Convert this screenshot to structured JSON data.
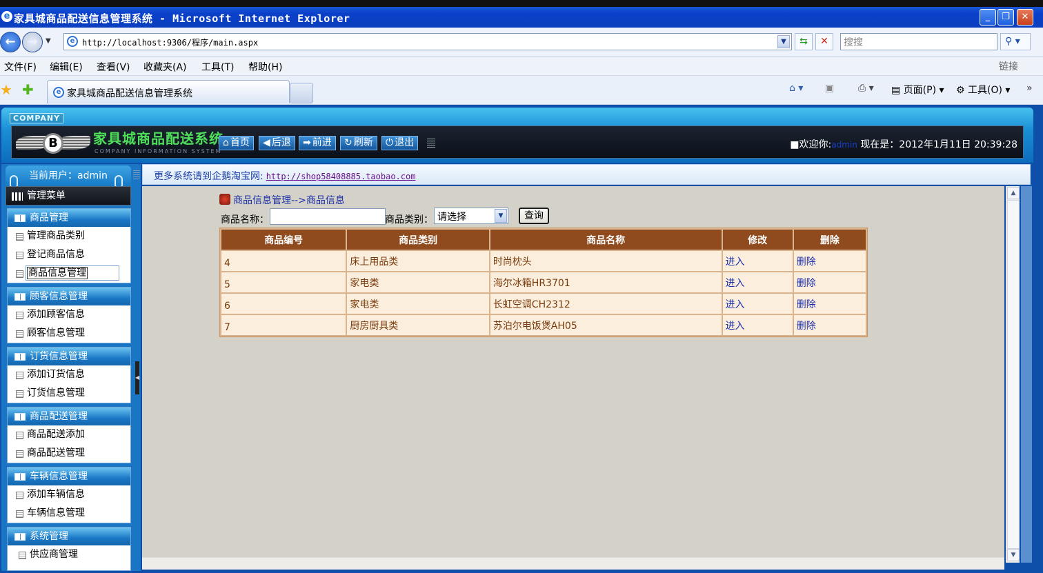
{
  "window": {
    "title": "家具城商品配送信息管理系统 - Microsoft Internet Explorer",
    "minimize": "_",
    "maximize": "❐",
    "close": "✕"
  },
  "address": {
    "url": "http://localhost:9306/程序/main.aspx",
    "search_placeholder": "搜搜"
  },
  "menubar": {
    "items": [
      "文件(F)",
      "编辑(E)",
      "查看(V)",
      "收藏夹(A)",
      "工具(T)",
      "帮助(H)"
    ],
    "links": "链接"
  },
  "tabbar": {
    "tab_title": "家具城商品配送信息管理系统",
    "page_label": "页面(P)",
    "tools_label": "工具(O)"
  },
  "header": {
    "company_tag": "COMPANY",
    "site_title": "家具城商品配送系统",
    "site_subtitle": "COMPANY INFORMATION SYSTEM",
    "nav": [
      "首页",
      "后退",
      "前进",
      "刷新",
      "退出"
    ],
    "welcome_prefix": "欢迎你:",
    "welcome_user": "admin",
    "time_label": "现在是：2012年1月11日 20:39:28"
  },
  "sidebar": {
    "current_user": "当前用户：admin",
    "menu_title": "管理菜单",
    "sections": [
      {
        "title": "商品管理",
        "items": [
          "管理商品类别",
          "登记商品信息",
          "商品信息管理"
        ]
      },
      {
        "title": "顾客信息管理",
        "items": [
          "添加顾客信息",
          "顾客信息管理"
        ]
      },
      {
        "title": "订货信息管理",
        "items": [
          "添加订货信息",
          "订货信息管理"
        ]
      },
      {
        "title": "商品配送管理",
        "items": [
          "商品配送添加",
          "商品配送管理"
        ]
      },
      {
        "title": "车辆信息管理",
        "items": [
          "添加车辆信息",
          "车辆信息管理"
        ]
      },
      {
        "title": "系统管理",
        "items": [
          "供应商管理"
        ]
      }
    ]
  },
  "notice": {
    "text": "更多系统请到企鹅淘宝网:",
    "url": "http://shop58408885.taobao.com"
  },
  "main": {
    "breadcrumb": "商品信息管理-->商品信息",
    "name_label": "商品名称：",
    "name_value": "",
    "category_label": "商品类别：",
    "category_selected": "请选择",
    "query_button": "查询",
    "columns": [
      "商品编号",
      "商品类别",
      "商品名称",
      "修改",
      "删除"
    ],
    "rows": [
      {
        "id": "4",
        "category": "床上用品类",
        "name": "时尚枕头",
        "edit": "进入",
        "delete": "删除"
      },
      {
        "id": "5",
        "category": "家电类",
        "name": "海尔冰箱HR3701",
        "edit": "进入",
        "delete": "删除"
      },
      {
        "id": "6",
        "category": "家电类",
        "name": "长虹空调CH2312",
        "edit": "进入",
        "delete": "删除"
      },
      {
        "id": "7",
        "category": "厨房厨具类",
        "name": "苏泊尔电饭煲AH05",
        "edit": "进入",
        "delete": "删除"
      }
    ]
  }
}
